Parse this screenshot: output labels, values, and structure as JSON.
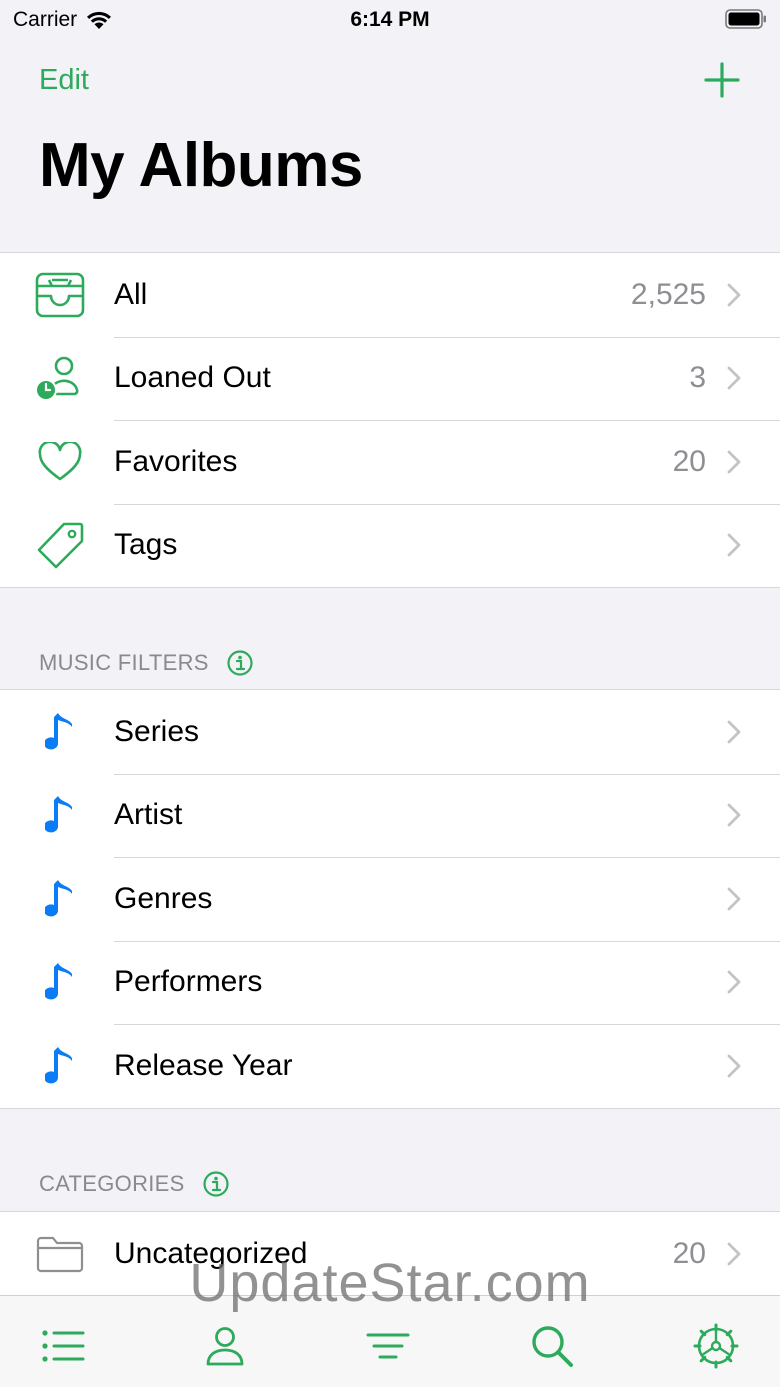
{
  "status_bar": {
    "carrier": "Carrier",
    "time": "6:14 PM"
  },
  "nav": {
    "edit_label": "Edit",
    "title": "My Albums"
  },
  "colors": {
    "accent": "#2daa5c",
    "music_note": "#0a7cf5",
    "text_secondary": "#8e8e93",
    "folder": "#8e8e93"
  },
  "library": {
    "items": [
      {
        "label": "All",
        "count": "2,525",
        "icon": "inbox-tray-icon"
      },
      {
        "label": "Loaned Out",
        "count": "3",
        "icon": "person-clock-icon"
      },
      {
        "label": "Favorites",
        "count": "20",
        "icon": "heart-icon"
      },
      {
        "label": "Tags",
        "count": "",
        "icon": "tag-icon"
      }
    ]
  },
  "music_filters": {
    "header": "MUSIC FILTERS",
    "items": [
      {
        "label": "Series",
        "icon": "music-note-icon"
      },
      {
        "label": "Artist",
        "icon": "music-note-icon"
      },
      {
        "label": "Genres",
        "icon": "music-note-icon"
      },
      {
        "label": "Performers",
        "icon": "music-note-icon"
      },
      {
        "label": "Release Year",
        "icon": "music-note-icon"
      }
    ]
  },
  "categories": {
    "header": "CATEGORIES",
    "items": [
      {
        "label": "Uncategorized",
        "count": "20",
        "icon": "folder-icon"
      }
    ]
  },
  "tab_bar": {
    "tabs": [
      {
        "name": "list",
        "icon": "list-icon"
      },
      {
        "name": "people",
        "icon": "person-icon"
      },
      {
        "name": "filter",
        "icon": "filter-icon"
      },
      {
        "name": "search",
        "icon": "search-icon"
      },
      {
        "name": "settings",
        "icon": "gear-icon"
      }
    ]
  },
  "watermark": "UpdateStar.com"
}
